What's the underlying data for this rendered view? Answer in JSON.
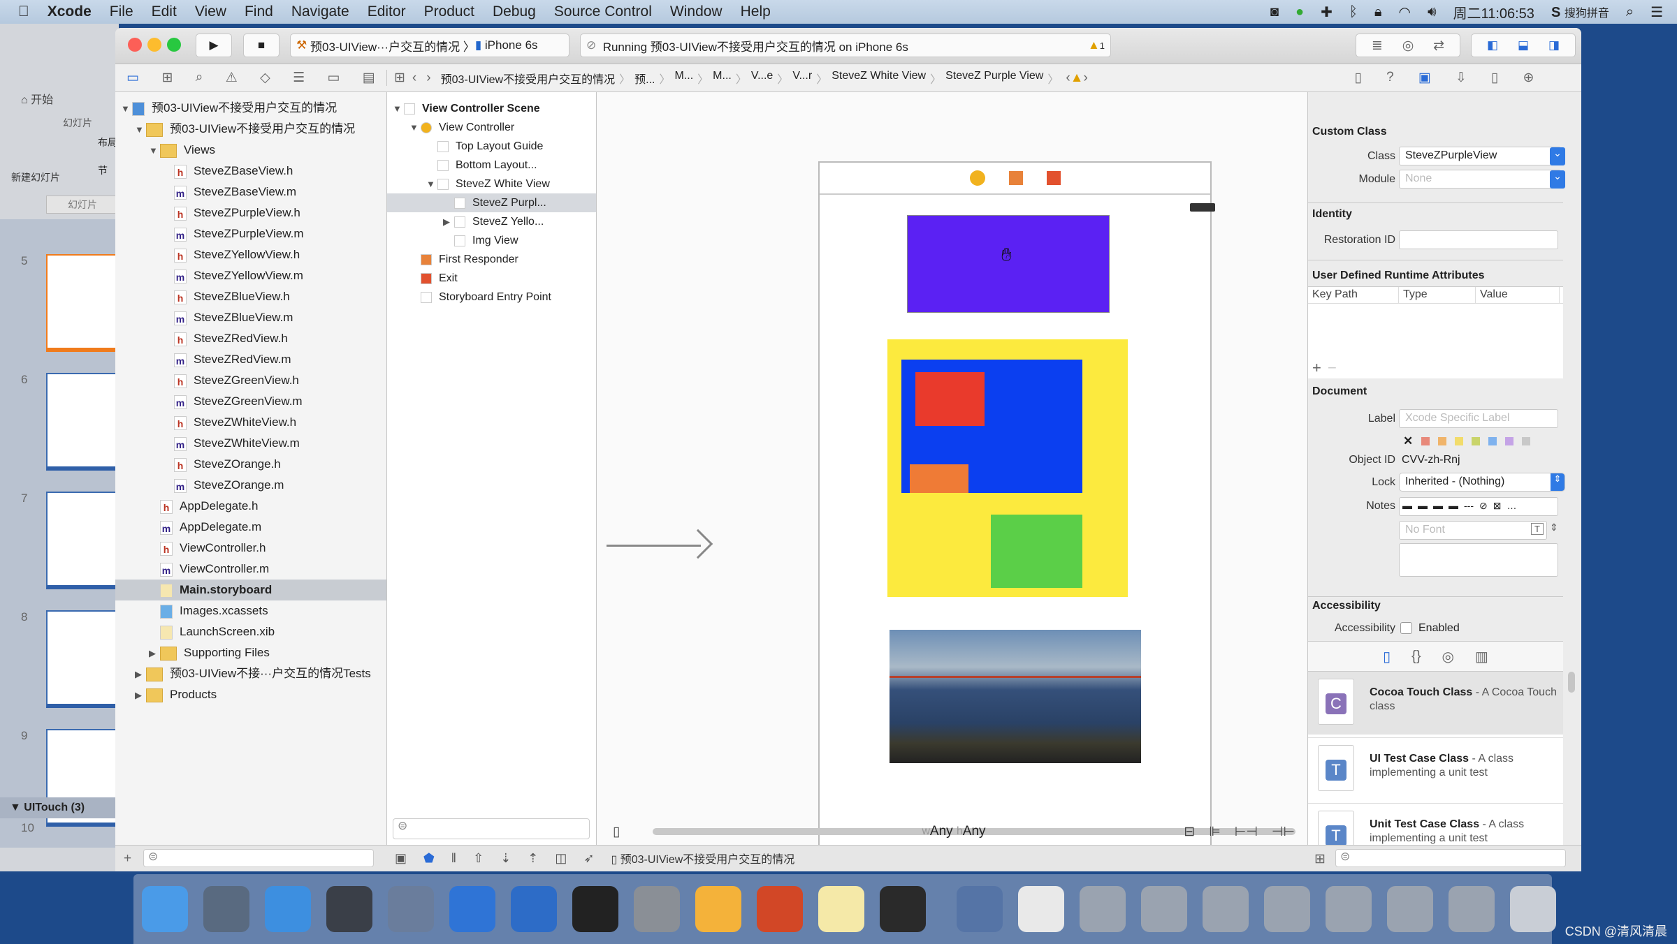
{
  "menubar": {
    "apple_icon": "apple-logo",
    "app": "Xcode",
    "items": [
      "File",
      "Edit",
      "View",
      "Find",
      "Navigate",
      "Editor",
      "Product",
      "Debug",
      "Source Control",
      "Window",
      "Help"
    ],
    "clock": "周二11:06:53",
    "ime": "搜狗拼音",
    "status_icons": [
      "screen-record-icon",
      "green-app-icon",
      "plus-icon",
      "bluetooth-icon",
      "lock-icon",
      "wifi-icon",
      "volume-icon"
    ]
  },
  "ppt": {
    "tab_start": "开始",
    "group": "幻灯片",
    "new_slide": "新建幻灯片",
    "layout": "布局",
    "section": "节",
    "panel_tab": "幻灯片",
    "slides": [
      "5",
      "6",
      "7",
      "8",
      "9"
    ],
    "section_name": "UITouch (3)",
    "next_slide": "10"
  },
  "toolbar": {
    "scheme": "预03-UIView···户交互的情况",
    "device": "iPhone 6s",
    "status": "Running 预03-UIView不接受用户交互的情况 on iPhone 6s",
    "warning_count": "1"
  },
  "jumpbar": {
    "items": [
      "预03-UIView不接受用户交互的情况",
      "预...",
      "M...",
      "M...",
      "V...e",
      "V...r",
      "SteveZ White View",
      "SteveZ Purple View"
    ]
  },
  "navigator": {
    "rows": [
      {
        "t": "预03-UIView不接受用户交互的情况",
        "i": "proj",
        "d": 0,
        "tri": "▼"
      },
      {
        "t": "预03-UIView不接受用户交互的情况",
        "i": "folder",
        "d": 1,
        "tri": "▼"
      },
      {
        "t": "Views",
        "i": "folder",
        "d": 2,
        "tri": "▼"
      },
      {
        "t": "SteveZBaseView.h",
        "i": "h",
        "d": 3
      },
      {
        "t": "SteveZBaseView.m",
        "i": "m",
        "d": 3
      },
      {
        "t": "SteveZPurpleView.h",
        "i": "h",
        "d": 3
      },
      {
        "t": "SteveZPurpleView.m",
        "i": "m",
        "d": 3
      },
      {
        "t": "SteveZYellowView.h",
        "i": "h",
        "d": 3
      },
      {
        "t": "SteveZYellowView.m",
        "i": "m",
        "d": 3
      },
      {
        "t": "SteveZBlueView.h",
        "i": "h",
        "d": 3
      },
      {
        "t": "SteveZBlueView.m",
        "i": "m",
        "d": 3
      },
      {
        "t": "SteveZRedView.h",
        "i": "h",
        "d": 3
      },
      {
        "t": "SteveZRedView.m",
        "i": "m",
        "d": 3
      },
      {
        "t": "SteveZGreenView.h",
        "i": "h",
        "d": 3
      },
      {
        "t": "SteveZGreenView.m",
        "i": "m",
        "d": 3
      },
      {
        "t": "SteveZWhiteView.h",
        "i": "h",
        "d": 3
      },
      {
        "t": "SteveZWhiteView.m",
        "i": "m",
        "d": 3
      },
      {
        "t": "SteveZOrange.h",
        "i": "h",
        "d": 3
      },
      {
        "t": "SteveZOrange.m",
        "i": "m",
        "d": 3
      },
      {
        "t": "AppDelegate.h",
        "i": "h",
        "d": 2
      },
      {
        "t": "AppDelegate.m",
        "i": "m",
        "d": 2
      },
      {
        "t": "ViewController.h",
        "i": "h",
        "d": 2
      },
      {
        "t": "ViewController.m",
        "i": "m",
        "d": 2
      },
      {
        "t": "Main.storyboard",
        "i": "sb",
        "d": 2,
        "sel": true
      },
      {
        "t": "Images.xcassets",
        "i": "xc",
        "d": 2
      },
      {
        "t": "LaunchScreen.xib",
        "i": "sb",
        "d": 2
      },
      {
        "t": "Supporting Files",
        "i": "folder",
        "d": 2,
        "tri": "▶"
      },
      {
        "t": "预03-UIView不接···户交互的情况Tests",
        "i": "folder",
        "d": 1,
        "tri": "▶"
      },
      {
        "t": "Products",
        "i": "folder",
        "d": 1,
        "tri": "▶"
      }
    ]
  },
  "outline": {
    "rows": [
      {
        "t": "View Controller Scene",
        "d": 0,
        "tri": "▼",
        "bold": true
      },
      {
        "t": "View Controller",
        "d": 1,
        "tri": "▼"
      },
      {
        "t": "Top Layout Guide",
        "d": 2
      },
      {
        "t": "Bottom Layout...",
        "d": 2
      },
      {
        "t": "SteveZ White View",
        "d": 2,
        "tri": "▼"
      },
      {
        "t": "SteveZ Purpl...",
        "d": 3,
        "sel": true
      },
      {
        "t": "SteveZ Yello...",
        "d": 3,
        "tri": "▶"
      },
      {
        "t": "Img View",
        "d": 3
      },
      {
        "t": "First Responder",
        "d": 1
      },
      {
        "t": "Exit",
        "d": 1
      },
      {
        "t": "Storyboard Entry Point",
        "d": 1
      }
    ]
  },
  "canvas": {
    "size_class_w": "w",
    "size_class_w_val": "Any",
    "size_class_h": "h",
    "size_class_h_val": "Any",
    "colors": {
      "purple": "#5b21f3",
      "yellow": "#fcea3e",
      "blue": "#0b3ff0",
      "red": "#e93a2c",
      "orange": "#ef7b36",
      "green": "#5bcf48"
    }
  },
  "inspector": {
    "custom_class": "Custom Class",
    "class_label": "Class",
    "class_value": "SteveZPurpleView",
    "module_label": "Module",
    "module_placeholder": "None",
    "identity": "Identity",
    "restoration_label": "Restoration ID",
    "udra": "User Defined Runtime Attributes",
    "cols": [
      "Key Path",
      "Type",
      "Value"
    ],
    "document": "Document",
    "doc_label": "Label",
    "doc_label_placeholder": "Xcode Specific Label",
    "label_colors": [
      "#e8897a",
      "#f0b46a",
      "#f2dc6b",
      "#c9d46a",
      "#7fb2ee",
      "#c4a3e6",
      "#c8c8c8"
    ],
    "object_id_label": "Object ID",
    "object_id": "CVV-zh-Rnj",
    "lock_label": "Lock",
    "lock_value": "Inherited - (Nothing)",
    "notes_label": "Notes",
    "font_placeholder": "No Font",
    "accessibility": "Accessibility",
    "acc_label": "Accessibility",
    "enabled": "Enabled",
    "library": [
      {
        "icon": "C",
        "color": "#8a72b8",
        "title": "Cocoa Touch Class",
        "desc": " - A Cocoa Touch class"
      },
      {
        "icon": "T",
        "color": "#5a86c8",
        "title": "UI Test Case Class",
        "desc": " - A class implementing a unit test"
      },
      {
        "icon": "T",
        "color": "#5a86c8",
        "title": "Unit Test Case Class",
        "desc": " - A class implementing a unit test"
      }
    ]
  },
  "debugbar": {
    "target": "预03-UIView不接受用户交互的情况"
  },
  "dock": {
    "apps": [
      {
        "n": "finder",
        "c": "#4a9be8"
      },
      {
        "n": "launchpad",
        "c": "#596a80"
      },
      {
        "n": "safari",
        "c": "#3d8fe0"
      },
      {
        "n": "mouse",
        "c": "#3a3f48"
      },
      {
        "n": "photo-slideshow",
        "c": "#6a7d9c"
      },
      {
        "n": "xcode",
        "c": "#2f74d6"
      },
      {
        "n": "instruments",
        "c": "#2d6cc7"
      },
      {
        "n": "terminal",
        "c": "#222"
      },
      {
        "n": "system-preferences",
        "c": "#8a8f96"
      },
      {
        "n": "sketch",
        "c": "#f4b23a"
      },
      {
        "n": "powerpoint",
        "c": "#d24726"
      },
      {
        "n": "notes",
        "c": "#f5e9a8"
      },
      {
        "n": "console",
        "c": "#2a2a2a"
      },
      {
        "n": "quicktime",
        "c": "#5574a6"
      },
      {
        "n": "preview",
        "c": "#e9e9e9"
      },
      {
        "n": "window-1",
        "c": "#9aa3b0"
      },
      {
        "n": "window-2",
        "c": "#9aa3b0"
      },
      {
        "n": "window-3",
        "c": "#9aa3b0"
      },
      {
        "n": "window-4",
        "c": "#9aa3b0"
      },
      {
        "n": "window-5",
        "c": "#9aa3b0"
      },
      {
        "n": "window-6",
        "c": "#9aa3b0"
      },
      {
        "n": "window-7",
        "c": "#9aa3b0"
      },
      {
        "n": "trash",
        "c": "#c9ced6"
      }
    ]
  },
  "watermark": "CSDN @清风清晨"
}
